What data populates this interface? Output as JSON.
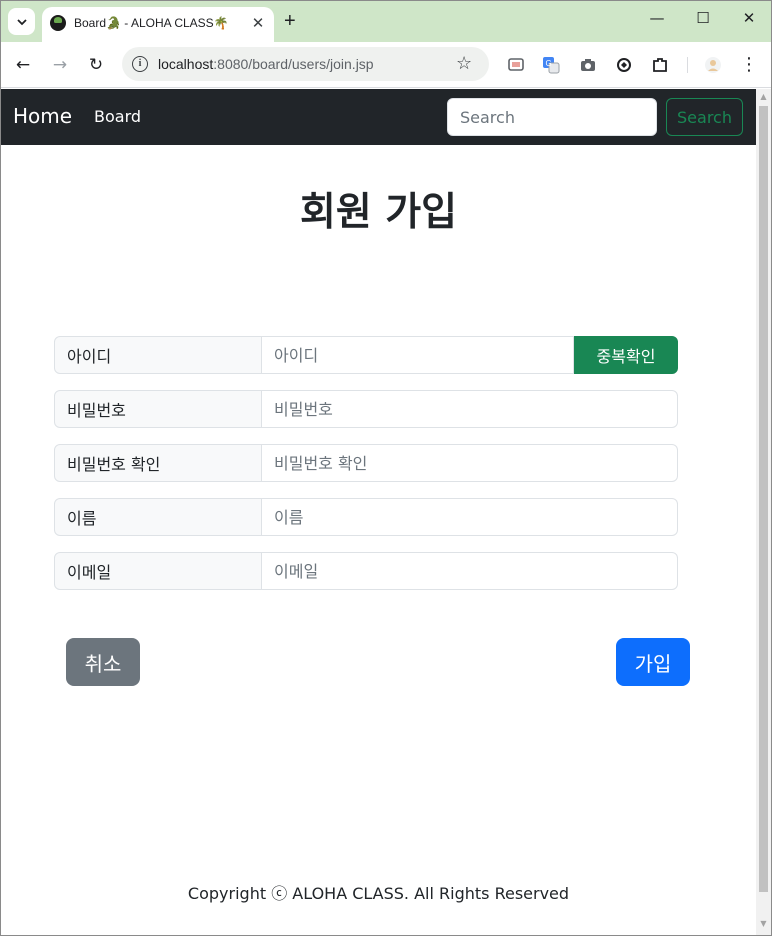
{
  "browser": {
    "tab_title": "Board🐊 - ALOHA CLASS🌴",
    "tab_close": "✕",
    "new_tab": "+",
    "url_host": "localhost",
    "url_path": ":8080/board/users/join.jsp",
    "window_controls": {
      "minimize": "—",
      "maximize": "☐",
      "close": "✕"
    },
    "nav": {
      "back": "←",
      "forward": "→",
      "reload": "↻"
    },
    "star": "☆",
    "menu": "⋮"
  },
  "navbar": {
    "brand": "Home",
    "link": "Board",
    "search_placeholder": "Search",
    "search_button": "Search",
    "accent": "#198754",
    "background": "#212529"
  },
  "form": {
    "title": "회원 가입",
    "fields": [
      {
        "label": "아이디",
        "placeholder": "아이디"
      },
      {
        "label": "비밀번호",
        "placeholder": "비밀번호"
      },
      {
        "label": "비밀번호 확인",
        "placeholder": "비밀번호 확인"
      },
      {
        "label": "이름",
        "placeholder": "이름"
      },
      {
        "label": "이메일",
        "placeholder": "이메일"
      }
    ],
    "check_button": "중복확인",
    "cancel_button": "취소",
    "submit_button": "가입"
  },
  "footer": {
    "text": "Copyright ⓒ ALOHA CLASS. All Rights Reserved"
  },
  "colors": {
    "primary": "#0d6efd",
    "secondary": "#6c757d",
    "success": "#198754",
    "tabstrip": "#cfe6c8"
  }
}
